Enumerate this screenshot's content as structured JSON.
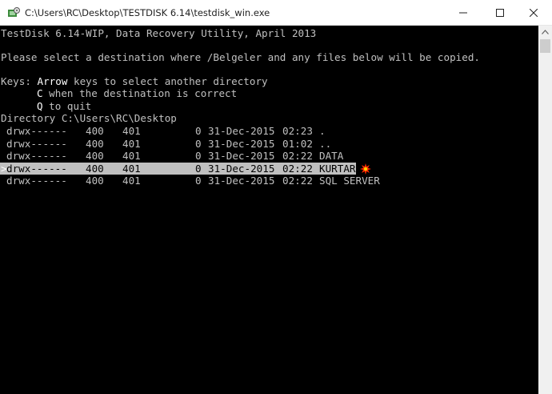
{
  "window": {
    "title": "C:\\Users\\RC\\Desktop\\TESTDISK 6.14\\testdisk_win.exe",
    "icon": "testdisk-app-icon",
    "controls": [
      "minimize-icon",
      "maximize-icon",
      "close-icon"
    ]
  },
  "console": {
    "header": "TestDisk 6.14-WIP, Data Recovery Utility, April 2013",
    "prompt": "Please select a destination where /Belgeler and any files below will be copied.",
    "keys": {
      "line1_prefix": "Keys: ",
      "line1_key": "Arrow",
      "line1_rest": " keys to select another directory",
      "line2_key": "C",
      "line2_rest": " when the destination is correct",
      "line3_key": "Q",
      "line3_rest": " to quit"
    },
    "directory_line": "Directory C:\\Users\\RC\\Desktop",
    "entries": [
      {
        "marker": " ",
        "perms": "drwx------",
        "uid": "400",
        "gid": "401",
        "size": "0",
        "date": "31-Dec-2015",
        "time": "02:23",
        "name": ".",
        "selected": false
      },
      {
        "marker": " ",
        "perms": "drwx------",
        "uid": "400",
        "gid": "401",
        "size": "0",
        "date": "31-Dec-2015",
        "time": "01:02",
        "name": "..",
        "selected": false
      },
      {
        "marker": " ",
        "perms": "drwx------",
        "uid": "400",
        "gid": "401",
        "size": "0",
        "date": "31-Dec-2015",
        "time": "02:22",
        "name": "DATA",
        "selected": false
      },
      {
        "marker": ">",
        "perms": "drwx------",
        "uid": "400",
        "gid": "401",
        "size": "0",
        "date": "31-Dec-2015",
        "time": "02:22",
        "name": "KURTAR",
        "selected": true
      },
      {
        "marker": " ",
        "perms": "drwx------",
        "uid": "400",
        "gid": "401",
        "size": "0",
        "date": "31-Dec-2015",
        "time": "02:22",
        "name": "SQL SERVER",
        "selected": false
      }
    ]
  },
  "annotation": {
    "icon": "red-burst-marker-icon",
    "color": "#ff2a00"
  },
  "colors": {
    "console_bg": "#000000",
    "console_text": "#c0c0c0",
    "highlight_text": "#ffffff",
    "selection_bg": "#c0c0c0"
  }
}
